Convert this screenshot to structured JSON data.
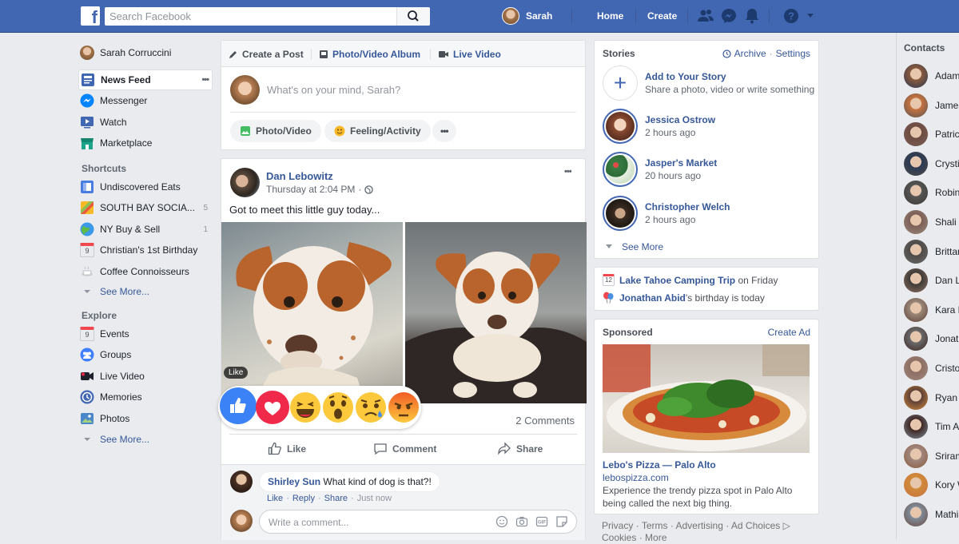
{
  "topbar": {
    "logo": "f",
    "search_placeholder": "Search Facebook",
    "user_name": "Sarah",
    "nav_home": "Home",
    "nav_create": "Create",
    "icons": [
      "friends-icon",
      "messenger-icon",
      "notifications-icon",
      "help-icon",
      "caret-down-icon"
    ],
    "brand_color": "#4267b2"
  },
  "leftnav": {
    "profile_name": "Sarah Corruccini",
    "main": [
      {
        "label": "News Feed",
        "icon": "news-feed-icon",
        "active": true
      },
      {
        "label": "Messenger",
        "icon": "messenger-icon"
      },
      {
        "label": "Watch",
        "icon": "watch-icon"
      },
      {
        "label": "Marketplace",
        "icon": "marketplace-icon"
      }
    ],
    "more_dots": "•••",
    "shortcuts_heading": "Shortcuts",
    "shortcuts": [
      {
        "label": "Undiscovered Eats",
        "badge": ""
      },
      {
        "label": "SOUTH BAY SOCIA...",
        "badge": "5"
      },
      {
        "label": "NY Buy & Sell",
        "badge": "1"
      },
      {
        "label": "Christian's 1st Birthday",
        "badge": "",
        "icon_text": "9"
      },
      {
        "label": "Coffee Connoisseurs",
        "badge": ""
      }
    ],
    "see_more_1": "See More...",
    "explore_heading": "Explore",
    "explore": [
      {
        "label": "Events",
        "icon_text": "9"
      },
      {
        "label": "Groups"
      },
      {
        "label": "Live Video"
      },
      {
        "label": "Memories"
      },
      {
        "label": "Photos"
      }
    ],
    "see_more_2": "See More..."
  },
  "composer": {
    "tab_create": "Create a Post",
    "tab_album": "Photo/Video Album",
    "tab_live": "Live Video",
    "placeholder": "What's on your mind, Sarah?",
    "btn_photo": "Photo/Video",
    "btn_feeling": "Feeling/Activity",
    "btn_more": "•••"
  },
  "post": {
    "author": "Dan Lebowitz",
    "time": "Thursday at 2:04 PM",
    "separator": "·",
    "more": "•••",
    "text": "Got to meet this little guy today...",
    "like_tooltip": "Like",
    "comments_count": "2 Comments",
    "actions": {
      "like": "Like",
      "comment": "Comment",
      "share": "Share"
    },
    "reactions": [
      "like-reaction-icon",
      "love-reaction-icon",
      "haha-reaction-icon",
      "wow-reaction-icon",
      "sad-reaction-icon",
      "angry-reaction-icon"
    ],
    "comment": {
      "author": "Shirley Sun",
      "text": "What kind of dog is that?!",
      "like": "Like",
      "reply": "Reply",
      "share": "Share",
      "sep": "·",
      "time": "Just now"
    },
    "write_placeholder": "Write a comment..."
  },
  "stories": {
    "title": "Stories",
    "archive": "Archive",
    "settings": "Settings",
    "dot": "·",
    "add_title": "Add to Your Story",
    "add_sub": "Share a photo, video or write something",
    "items": [
      {
        "name": "Jessica Ostrow",
        "time": "2 hours ago"
      },
      {
        "name": "Jasper's Market",
        "time": "20 hours ago"
      },
      {
        "name": "Christopher Welch",
        "time": "2 hours ago"
      }
    ],
    "see_more": "See More"
  },
  "events": {
    "event_name": "Lake Tahoe Camping Trip",
    "event_when": " on Friday",
    "birthday_name": "Jonathan Abid",
    "birthday_text": "'s birthday is today"
  },
  "sponsored": {
    "title": "Sponsored",
    "create_ad": "Create Ad",
    "ad_title": "Lebo's Pizza — Palo Alto",
    "ad_url": "lebospizza.com",
    "ad_desc": "Experience the trendy pizza spot in Palo Alto being called the next big thing."
  },
  "footer": {
    "links": [
      "Privacy",
      "Terms",
      "Advertising",
      "Ad Choices",
      "Cookies",
      "More"
    ],
    "sep": "·",
    "adchoices_icon": "▷"
  },
  "contacts": {
    "title": "Contacts",
    "items": [
      "Adam",
      "James",
      "Patrick",
      "Crystin",
      "Robin",
      "Shali F",
      "Brittany",
      "Dan L",
      "Kara F",
      "Jonath",
      "Cristof",
      "Ryan F",
      "Tim A",
      "Sriram",
      "Kory W",
      "Mathia"
    ]
  }
}
